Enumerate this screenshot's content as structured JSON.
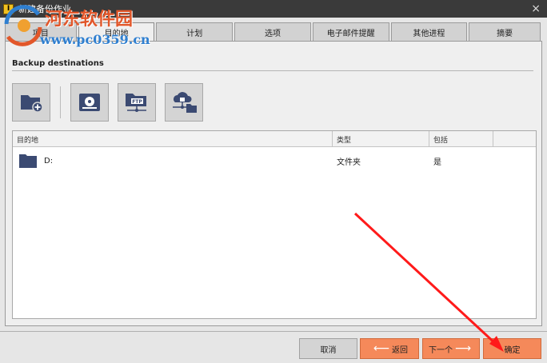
{
  "window": {
    "title": "新建备份作业",
    "close_glyph": "×"
  },
  "watermark": {
    "title": "河东软件园",
    "url": "www.pc0359.cn"
  },
  "tabs": [
    {
      "label": "项目"
    },
    {
      "label": "目的地"
    },
    {
      "label": "计划"
    },
    {
      "label": "选项"
    },
    {
      "label": "电子邮件提醒"
    },
    {
      "label": "其他进程"
    },
    {
      "label": "摘要"
    }
  ],
  "active_tab": "目的地",
  "section": {
    "title": "Backup destinations"
  },
  "toolbar": {
    "icons": [
      "add-folder-icon",
      "disc-drive-icon",
      "ftp-folder-icon",
      "cloud-network-icon"
    ]
  },
  "list": {
    "columns": [
      "目的地",
      "类型",
      "包括"
    ],
    "rows": [
      {
        "destination": "D:",
        "type": "文件夹",
        "included": "是"
      }
    ]
  },
  "buttons": {
    "cancel": "取消",
    "back": "返回",
    "next": "下一个",
    "ok": "确定"
  },
  "colors": {
    "titlebar": "#3a3a3a",
    "accent_button": "#f5895a",
    "folder_icon": "#3b4a72",
    "annotation_arrow": "#ff1a1a"
  }
}
